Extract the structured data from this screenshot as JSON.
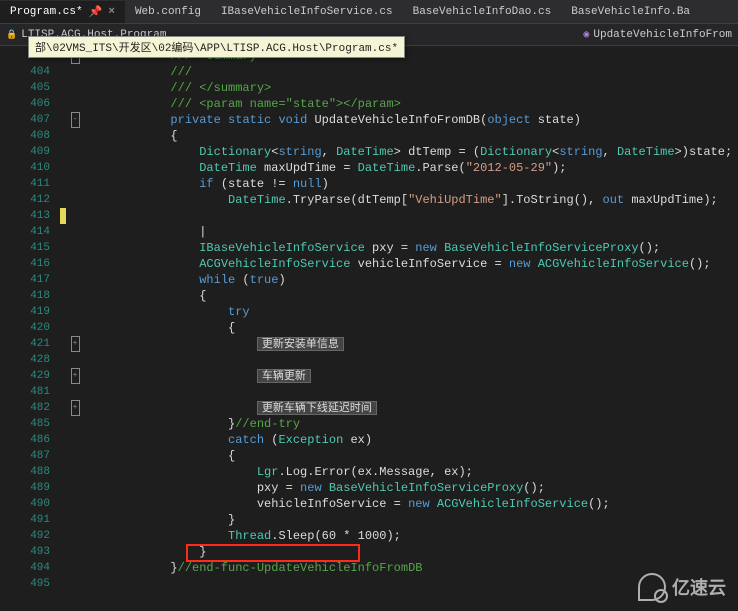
{
  "tabs": {
    "active": "Program.cs*",
    "others": [
      "Web.config",
      "IBaseVehicleInfoService.cs",
      "BaseVehicleInfoDao.cs",
      "BaseVehicleInfo.Ba"
    ]
  },
  "breadcrumb": {
    "left": "LTISP.ACG.Host.Program",
    "right": "UpdateVehicleInfoFrom"
  },
  "tooltip_path": "部\\02VMS_ITS\\开发区\\02编码\\APP\\LTISP.ACG.Host\\Program.cs*",
  "line_numbers": [
    403,
    404,
    405,
    406,
    407,
    408,
    409,
    410,
    411,
    412,
    413,
    414,
    415,
    416,
    417,
    418,
    419,
    420,
    421,
    428,
    429,
    481,
    482,
    485,
    486,
    487,
    488,
    489,
    490,
    491,
    492,
    493,
    494,
    495
  ],
  "fold_marks": {
    "403": "-",
    "407": "-",
    "421": "+",
    "429": "+",
    "482": "+"
  },
  "code": {
    "403": {
      "indent": "            ",
      "type": "comment",
      "text": "/// <summary>"
    },
    "404": {
      "indent": "            ",
      "type": "comment",
      "text": "///"
    },
    "405": {
      "indent": "            ",
      "type": "comment",
      "text": "/// </summary>"
    },
    "406": {
      "indent": "            ",
      "type": "comment",
      "text": "/// <param name=\"state\"></param>"
    },
    "407": {
      "indent": "            ",
      "tokens": [
        [
          "kw",
          "private"
        ],
        [
          "pl",
          " "
        ],
        [
          "kw",
          "static"
        ],
        [
          "pl",
          " "
        ],
        [
          "kw",
          "void"
        ],
        [
          "pl",
          " "
        ],
        [
          "pl",
          "UpdateVehicleInfoFromDB("
        ],
        [
          "kw",
          "object"
        ],
        [
          "pl",
          " state)"
        ]
      ]
    },
    "408": {
      "indent": "            ",
      "tokens": [
        [
          "pl",
          "{"
        ]
      ]
    },
    "409": {
      "indent": "                ",
      "tokens": [
        [
          "ty",
          "Dictionary"
        ],
        [
          "pl",
          "<"
        ],
        [
          "kw",
          "string"
        ],
        [
          "pl",
          ", "
        ],
        [
          "ty",
          "DateTime"
        ],
        [
          "pl",
          "> dtTemp = ("
        ],
        [
          "ty",
          "Dictionary"
        ],
        [
          "pl",
          "<"
        ],
        [
          "kw",
          "string"
        ],
        [
          "pl",
          ", "
        ],
        [
          "ty",
          "DateTime"
        ],
        [
          "pl",
          ">)state;"
        ]
      ]
    },
    "410": {
      "indent": "                ",
      "tokens": [
        [
          "ty",
          "DateTime"
        ],
        [
          "pl",
          " maxUpdTime = "
        ],
        [
          "ty",
          "DateTime"
        ],
        [
          "pl",
          ".Parse("
        ],
        [
          "st",
          "\"2012-05-29\""
        ],
        [
          "pl",
          ");"
        ]
      ]
    },
    "411": {
      "indent": "                ",
      "tokens": [
        [
          "kw",
          "if"
        ],
        [
          "pl",
          " (state != "
        ],
        [
          "kw",
          "null"
        ],
        [
          "pl",
          ")"
        ]
      ]
    },
    "412": {
      "indent": "                    ",
      "tokens": [
        [
          "ty",
          "DateTime"
        ],
        [
          "pl",
          ".TryParse(dtTemp["
        ],
        [
          "st",
          "\"VehiUpdTime\""
        ],
        [
          "pl",
          "].ToString(), "
        ],
        [
          "kw",
          "out"
        ],
        [
          "pl",
          " maxUpdTime);"
        ]
      ]
    },
    "413": {
      "indent": "",
      "tokens": []
    },
    "414": {
      "indent": "                ",
      "tokens": [
        [
          "pl",
          "|"
        ]
      ]
    },
    "415": {
      "indent": "                ",
      "tokens": [
        [
          "ty",
          "IBaseVehicleInfoService"
        ],
        [
          "pl",
          " pxy = "
        ],
        [
          "kw",
          "new"
        ],
        [
          "pl",
          " "
        ],
        [
          "ty",
          "BaseVehicleInfoServiceProxy"
        ],
        [
          "pl",
          "();"
        ]
      ]
    },
    "416": {
      "indent": "                ",
      "tokens": [
        [
          "ty",
          "ACGVehicleInfoService"
        ],
        [
          "pl",
          " vehicleInfoService = "
        ],
        [
          "kw",
          "new"
        ],
        [
          "pl",
          " "
        ],
        [
          "ty",
          "ACGVehicleInfoService"
        ],
        [
          "pl",
          "();"
        ]
      ]
    },
    "417": {
      "indent": "                ",
      "tokens": [
        [
          "kw",
          "while"
        ],
        [
          "pl",
          " ("
        ],
        [
          "kw",
          "true"
        ],
        [
          "pl",
          ")"
        ]
      ]
    },
    "418": {
      "indent": "                ",
      "tokens": [
        [
          "pl",
          "{"
        ]
      ]
    },
    "419": {
      "indent": "                    ",
      "tokens": [
        [
          "kw",
          "try"
        ]
      ]
    },
    "420": {
      "indent": "                    ",
      "tokens": [
        [
          "pl",
          "{"
        ]
      ]
    },
    "421": {
      "indent": "                        ",
      "region": "更新安装单信息"
    },
    "428": {
      "indent": "",
      "tokens": []
    },
    "429": {
      "indent": "                        ",
      "region": "车辆更新"
    },
    "481": {
      "indent": "",
      "tokens": []
    },
    "482": {
      "indent": "                        ",
      "region": "更新车辆下线延迟时间"
    },
    "485": {
      "indent": "                    ",
      "tokens": [
        [
          "pl",
          "}"
        ],
        [
          "cm",
          "//end-try"
        ]
      ]
    },
    "486": {
      "indent": "                    ",
      "tokens": [
        [
          "kw",
          "catch"
        ],
        [
          "pl",
          " ("
        ],
        [
          "ty",
          "Exception"
        ],
        [
          "pl",
          " ex)"
        ]
      ]
    },
    "487": {
      "indent": "                    ",
      "tokens": [
        [
          "pl",
          "{"
        ]
      ]
    },
    "488": {
      "indent": "                        ",
      "tokens": [
        [
          "ty",
          "Lgr"
        ],
        [
          "pl",
          ".Log.Error(ex.Message, ex);"
        ]
      ]
    },
    "489": {
      "indent": "                        ",
      "tokens": [
        [
          "pl",
          "pxy = "
        ],
        [
          "kw",
          "new"
        ],
        [
          "pl",
          " "
        ],
        [
          "ty",
          "BaseVehicleInfoServiceProxy"
        ],
        [
          "pl",
          "();"
        ]
      ]
    },
    "490": {
      "indent": "                        ",
      "tokens": [
        [
          "pl",
          "vehicleInfoService = "
        ],
        [
          "kw",
          "new"
        ],
        [
          "pl",
          " "
        ],
        [
          "ty",
          "ACGVehicleInfoService"
        ],
        [
          "pl",
          "();"
        ]
      ]
    },
    "491": {
      "indent": "                    ",
      "tokens": [
        [
          "pl",
          "}"
        ]
      ]
    },
    "492": {
      "indent": "                    ",
      "tokens": [
        [
          "ty",
          "Thread"
        ],
        [
          "pl",
          ".Sleep(60 * 1000);"
        ]
      ]
    },
    "493": {
      "indent": "                ",
      "tokens": [
        [
          "pl",
          "}"
        ]
      ]
    },
    "494": {
      "indent": "            ",
      "tokens": [
        [
          "pl",
          "}"
        ],
        [
          "cm",
          "//end-func-UpdateVehicleInfoFromDB"
        ]
      ]
    },
    "495": {
      "indent": "",
      "tokens": []
    }
  },
  "watermark": "亿速云"
}
